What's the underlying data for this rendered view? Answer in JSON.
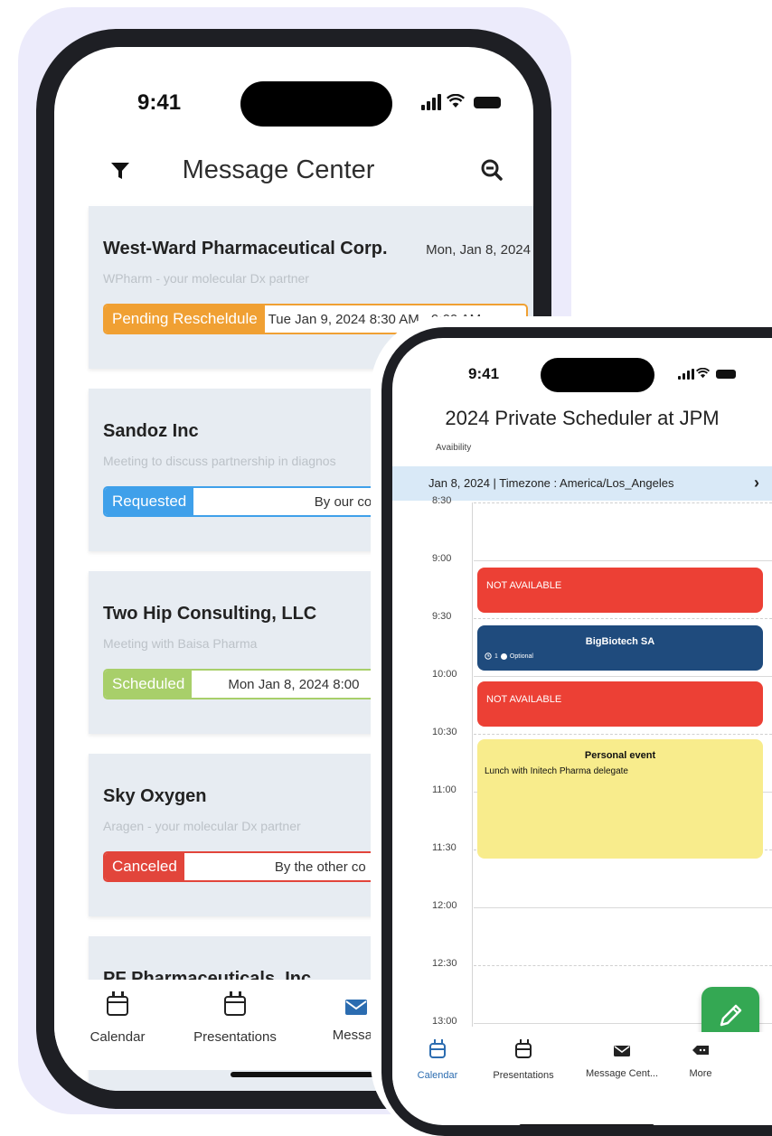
{
  "colors": {
    "backdrop": "#ecebfb",
    "pending": "#f0a033",
    "requested": "#3fa0ea",
    "scheduled": "#a8cf6a",
    "canceled": "#e2453b",
    "not_available": "#ec4035",
    "bigbiotech": "#1f4b7d",
    "personal": "#f8ec8c",
    "fab": "#34a853",
    "date_bar": "#d9e9f7"
  },
  "phone1": {
    "status_time": "9:41",
    "header": {
      "title": "Message Center",
      "filter_icon": "filter-icon",
      "zoom_icon": "zoom-out-icon"
    },
    "cards": [
      {
        "company": "West-Ward Pharmaceutical Corp.",
        "date": "Mon, Jan 8, 2024",
        "subtitle": "WPharm - your molecular Dx partner",
        "status": "Pending Rescheldule",
        "info": "Tue Jan 9, 2024 8:30 AM - 9:00 AM"
      },
      {
        "company": "Sandoz Inc",
        "date": "",
        "subtitle": "Meeting to discuss partnership in diagnos",
        "status": "Requested",
        "info": "By our comp"
      },
      {
        "company": "Two Hip Consulting, LLC",
        "date": "",
        "subtitle": "Meeting with Baisa Pharma",
        "status": "Scheduled",
        "info": "Mon Jan 8, 2024 8:00"
      },
      {
        "company": "Sky Oxygen",
        "date": "",
        "subtitle": "Aragen - your molecular Dx partner",
        "status": "Canceled",
        "info": "By the other co"
      },
      {
        "company": "PF Pharmaceuticals, Inc",
        "date": "",
        "subtitle": "",
        "status": "",
        "info": ""
      }
    ],
    "tabs": [
      {
        "label": "Calendar",
        "icon": "calendar-icon"
      },
      {
        "label": "Presentations",
        "icon": "calendar-icon"
      },
      {
        "label": "Messag",
        "icon": "mail-icon"
      }
    ]
  },
  "phone2": {
    "status_time": "9:41",
    "title": "2024 Private Scheduler at JPM",
    "availability_label": "Avaibility",
    "date_bar": "Jan 8, 2024 | Timezone : America/Los_Angeles",
    "date_bar_chevron": "›",
    "time_slots": [
      "8:30",
      "9:00",
      "9:30",
      "10:00",
      "10:30",
      "11:00",
      "11:30",
      "12:00",
      "12:30",
      "13:00"
    ],
    "events": [
      {
        "title": "NOT AVAILABLE",
        "kind": "not_available"
      },
      {
        "title": "BigBiotech SA",
        "kind": "meeting",
        "meta_count": "1",
        "meta_label": "Optional"
      },
      {
        "title": "NOT AVAILABLE",
        "kind": "not_available"
      },
      {
        "title": "Personal event",
        "kind": "personal",
        "description": "Lunch with Initech Pharma delegate"
      }
    ],
    "fab_icon": "pencil-icon",
    "tabs": [
      {
        "label": "Calendar",
        "icon": "calendar-icon",
        "active": true
      },
      {
        "label": "Presentations",
        "icon": "calendar-icon",
        "active": false
      },
      {
        "label": "Message Cent...",
        "icon": "mail-icon",
        "active": false
      },
      {
        "label": "More",
        "icon": "more-icon",
        "active": false
      }
    ]
  }
}
